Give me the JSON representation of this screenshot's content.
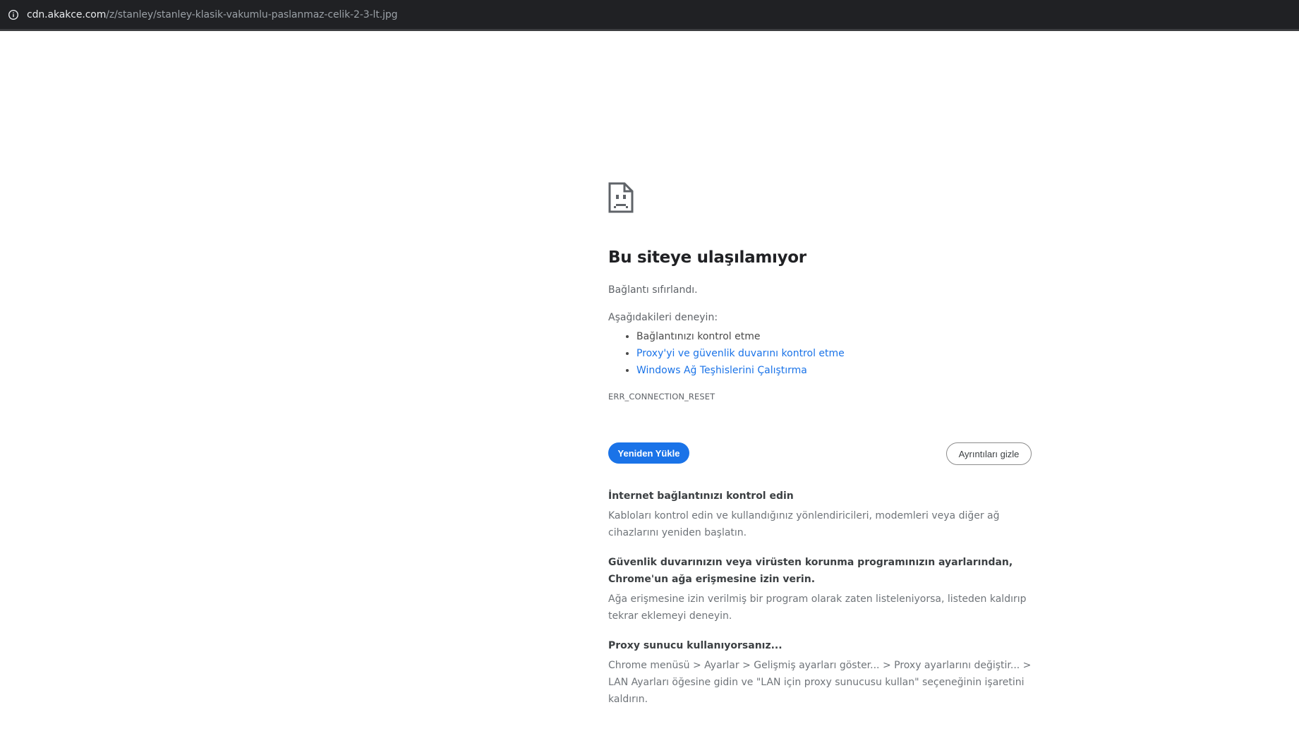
{
  "address_bar": {
    "host": "cdn.akakce.com",
    "path": "/z/stanley/stanley-klasik-vakumlu-paslanmaz-celik-2-3-lt.jpg",
    "site_info_icon": "info-circle-icon"
  },
  "error_page": {
    "icon": "sad-page-icon",
    "title": "Bu siteye ulaşılamıyor",
    "reason": "Bağlantı sıfırlandı.",
    "suggestions_heading": "Aşağıdakileri deneyin:",
    "suggestions": [
      {
        "label": "Bağlantınızı kontrol etme",
        "is_link": false
      },
      {
        "label": "Proxy'yi ve güvenlik duvarını kontrol etme",
        "is_link": true
      },
      {
        "label": "Windows Ağ Teşhislerini Çalıştırma",
        "is_link": true
      }
    ],
    "error_code": "ERR_CONNECTION_RESET",
    "reload_button": "Yeniden Yükle",
    "details_button": "Ayrıntıları gizle",
    "details": [
      {
        "title": "İnternet bağlantınızı kontrol edin",
        "text": "Kabloları kontrol edin ve kullandığınız yönlendiricileri, modemleri veya diğer ağ cihazlarını yeniden başlatın."
      },
      {
        "title": "Güvenlik duvarınızın veya virüsten korunma programınızın ayarlarından, Chrome'un ağa erişmesine izin verin.",
        "text": "Ağa erişmesine izin verilmiş bir program olarak zaten listeleniyorsa, listeden kaldırıp tekrar eklemeyi deneyin."
      },
      {
        "title": "Proxy sunucu kullanıyorsanız...",
        "text": "Chrome menüsü > Ayarlar > Gelişmiş ayarları göster... > Proxy ayarlarını değiştir... > LAN Ayarları öğesine gidin ve \"LAN için proxy sunucusu kullan\" seçeneğinin işaretini kaldırın."
      }
    ]
  },
  "colors": {
    "accent": "#1a73e8",
    "toolbar_bg": "#202124",
    "title_text": "#202124"
  }
}
